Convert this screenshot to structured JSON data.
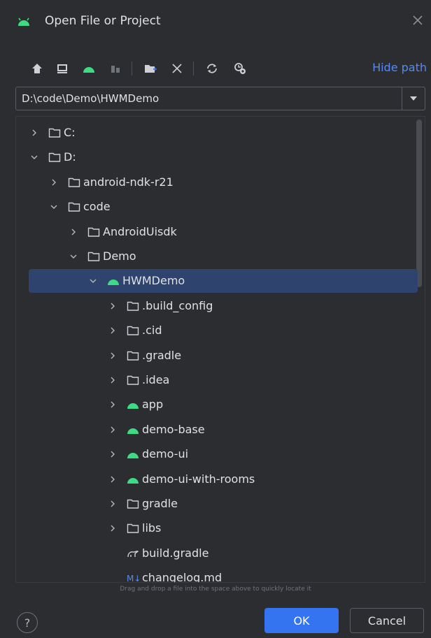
{
  "dialog": {
    "title": "Open File or Project",
    "hide_path_label": "Hide path",
    "path_value": "D:\\code\\Demo\\HWMDemo",
    "drop_hint": "Drag and drop a file into the space above to quickly locate it",
    "help_label": "?",
    "ok_label": "OK",
    "cancel_label": "Cancel"
  },
  "toolbar_icons": [
    "home-icon",
    "desktop-icon",
    "android-project-icon",
    "module-icon",
    "new-folder-icon",
    "delete-icon",
    "refresh-icon",
    "show-hidden-icon"
  ],
  "tree": [
    {
      "label": "C:",
      "indent": 0,
      "icon": "folder",
      "chevron": "right"
    },
    {
      "label": "D:",
      "indent": 0,
      "icon": "folder",
      "chevron": "down"
    },
    {
      "label": "android-ndk-r21",
      "indent": 1,
      "icon": "folder",
      "chevron": "right"
    },
    {
      "label": "code",
      "indent": 1,
      "icon": "folder",
      "chevron": "down"
    },
    {
      "label": "AndroidUisdk",
      "indent": 2,
      "icon": "folder",
      "chevron": "right"
    },
    {
      "label": "Demo",
      "indent": 2,
      "icon": "folder",
      "chevron": "down"
    },
    {
      "label": "HWMDemo",
      "indent": 3,
      "icon": "android",
      "chevron": "down",
      "selected": true
    },
    {
      "label": ".build_config",
      "indent": 4,
      "icon": "folder",
      "chevron": "right"
    },
    {
      "label": ".cid",
      "indent": 4,
      "icon": "folder",
      "chevron": "right"
    },
    {
      "label": ".gradle",
      "indent": 4,
      "icon": "folder",
      "chevron": "right"
    },
    {
      "label": ".idea",
      "indent": 4,
      "icon": "folder",
      "chevron": "right"
    },
    {
      "label": "app",
      "indent": 4,
      "icon": "android",
      "chevron": "right"
    },
    {
      "label": "demo-base",
      "indent": 4,
      "icon": "android",
      "chevron": "right"
    },
    {
      "label": "demo-ui",
      "indent": 4,
      "icon": "android",
      "chevron": "right"
    },
    {
      "label": "demo-ui-with-rooms",
      "indent": 4,
      "icon": "android",
      "chevron": "right"
    },
    {
      "label": "gradle",
      "indent": 4,
      "icon": "folder",
      "chevron": "right"
    },
    {
      "label": "libs",
      "indent": 4,
      "icon": "folder",
      "chevron": "right"
    },
    {
      "label": "build.gradle",
      "indent": 4,
      "icon": "gradle-file",
      "chevron": "none"
    },
    {
      "label": "changelog.md",
      "indent": 4,
      "icon": "markdown-file",
      "chevron": "none"
    }
  ],
  "colors": {
    "background": "#2b2d30",
    "selection": "#2e436e",
    "accent": "#3574f0",
    "link": "#548af7",
    "android": "#3ddc84"
  }
}
